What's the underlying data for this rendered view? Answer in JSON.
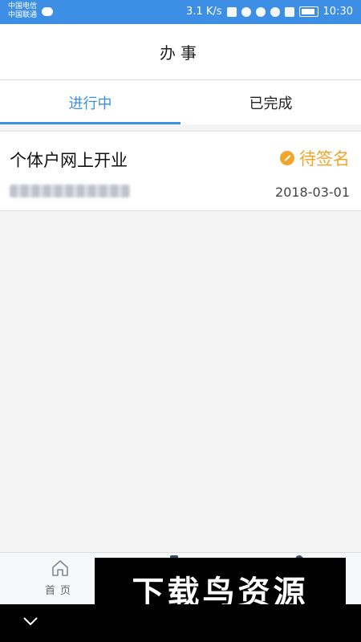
{
  "status_bar": {
    "carrier_1": "中国电信",
    "carrier_2": "中国联通",
    "net_speed": "3.1 K/s",
    "time": "10:30"
  },
  "header": {
    "title": "办事"
  },
  "tabs": [
    {
      "label": "进行中",
      "active": true
    },
    {
      "label": "已完成",
      "active": false
    }
  ],
  "items": [
    {
      "title": "个体户网上开业",
      "status": "待签名",
      "date": "2018-03-01"
    }
  ],
  "bottom_nav": {
    "home_label": "首页"
  },
  "watermark": {
    "text": "下载鸟资源"
  },
  "colors": {
    "accent": "#3d8ee5",
    "status": "#f0a62b"
  },
  "icons": [
    "wechat-icon",
    "pen-icon",
    "home-icon",
    "chevron-down-icon"
  ]
}
